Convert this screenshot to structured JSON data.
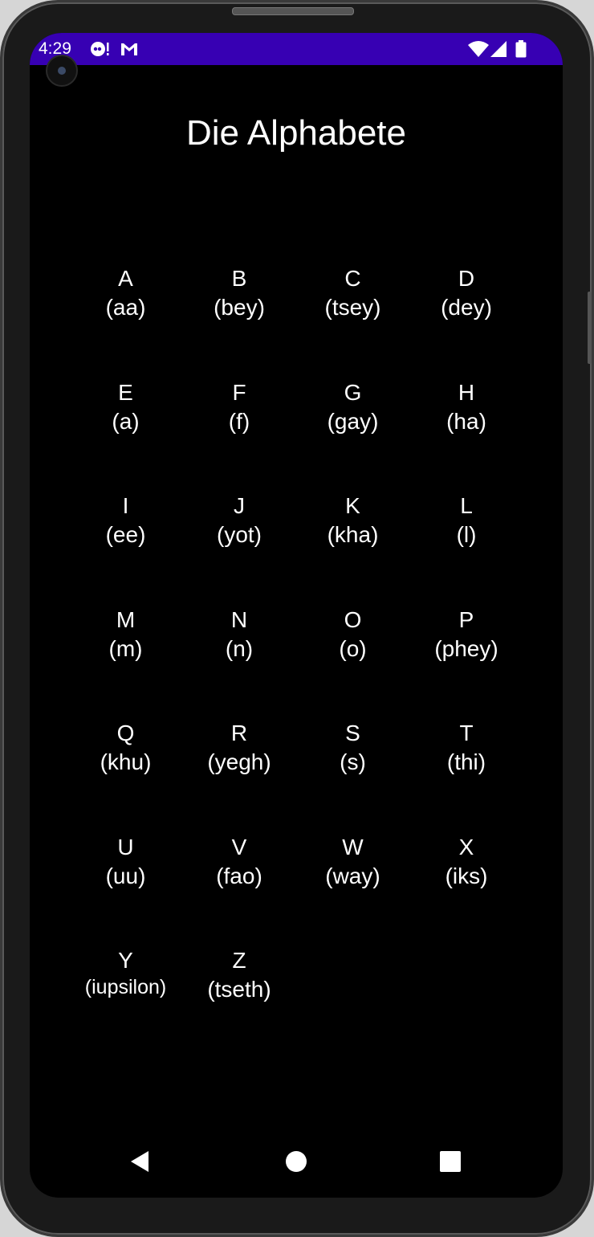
{
  "status_bar": {
    "time": "4:29",
    "color": "#3700b3",
    "icons": [
      "chat-bubble-notification-icon",
      "gmail-icon",
      "wifi-icon",
      "cell-signal-icon",
      "battery-icon"
    ]
  },
  "app": {
    "title": "Die Alphabete"
  },
  "alphabet": [
    {
      "letter": "A",
      "pron": "(aa)"
    },
    {
      "letter": "B",
      "pron": "(bey)"
    },
    {
      "letter": "C",
      "pron": "(tsey)"
    },
    {
      "letter": "D",
      "pron": "(dey)"
    },
    {
      "letter": "E",
      "pron": "(a)"
    },
    {
      "letter": "F",
      "pron": "(f)"
    },
    {
      "letter": "G",
      "pron": "(gay)"
    },
    {
      "letter": "H",
      "pron": "(ha)"
    },
    {
      "letter": "I",
      "pron": "(ee)"
    },
    {
      "letter": "J",
      "pron": "(yot)"
    },
    {
      "letter": "K",
      "pron": "(kha)"
    },
    {
      "letter": "L",
      "pron": "(l)"
    },
    {
      "letter": "M",
      "pron": "(m)"
    },
    {
      "letter": "N",
      "pron": "(n)"
    },
    {
      "letter": "O",
      "pron": "(o)"
    },
    {
      "letter": "P",
      "pron": "(phey)"
    },
    {
      "letter": "Q",
      "pron": "(khu)"
    },
    {
      "letter": "R",
      "pron": "(yegh)"
    },
    {
      "letter": "S",
      "pron": "(s)"
    },
    {
      "letter": "T",
      "pron": "(thi)"
    },
    {
      "letter": "U",
      "pron": "(uu)"
    },
    {
      "letter": "V",
      "pron": "(fao)"
    },
    {
      "letter": "W",
      "pron": "(way)"
    },
    {
      "letter": "X",
      "pron": "(iks)"
    },
    {
      "letter": "Y",
      "pron": "(iupsilon)"
    },
    {
      "letter": "Z",
      "pron": "(tseth)"
    }
  ],
  "nav_bar": {
    "icons": [
      "back-icon",
      "home-icon",
      "recents-icon"
    ]
  }
}
